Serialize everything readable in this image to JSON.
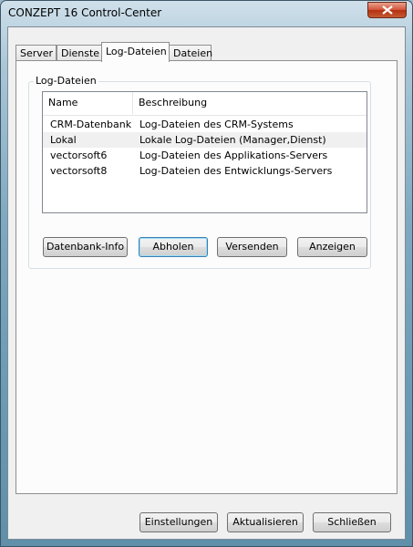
{
  "window": {
    "title": "CONZEPT 16 Control-Center"
  },
  "tabs": [
    {
      "label": "Server"
    },
    {
      "label": "Dienste"
    },
    {
      "label": "Log-Dateien"
    },
    {
      "label": "Dateien"
    }
  ],
  "active_tab": "Log-Dateien",
  "group": {
    "label": "Log-Dateien"
  },
  "list": {
    "columns": [
      "Name",
      "Beschreibung"
    ],
    "rows": [
      {
        "name": "CRM-Datenbank",
        "desc": "Log-Dateien des CRM-Systems"
      },
      {
        "name": "Lokal",
        "desc": "Lokale Log-Dateien (Manager,Dienst)"
      },
      {
        "name": "vectorsoft6",
        "desc": "Log-Dateien des Applikations-Servers"
      },
      {
        "name": "vectorsoft8",
        "desc": "Log-Dateien des Entwicklungs-Servers"
      }
    ],
    "selected_row": "Lokal"
  },
  "group_buttons": {
    "db_info": "Datenbank-Info",
    "fetch": "Abholen",
    "send": "Versenden",
    "show": "Anzeigen"
  },
  "footer_buttons": {
    "settings": "Einstellungen",
    "refresh": "Aktualisieren",
    "close": "Schließen"
  },
  "icons": {
    "close": "close-icon"
  },
  "colors": {
    "close_button": "#c84a2a",
    "default_button_border": "#3c7fb1"
  }
}
